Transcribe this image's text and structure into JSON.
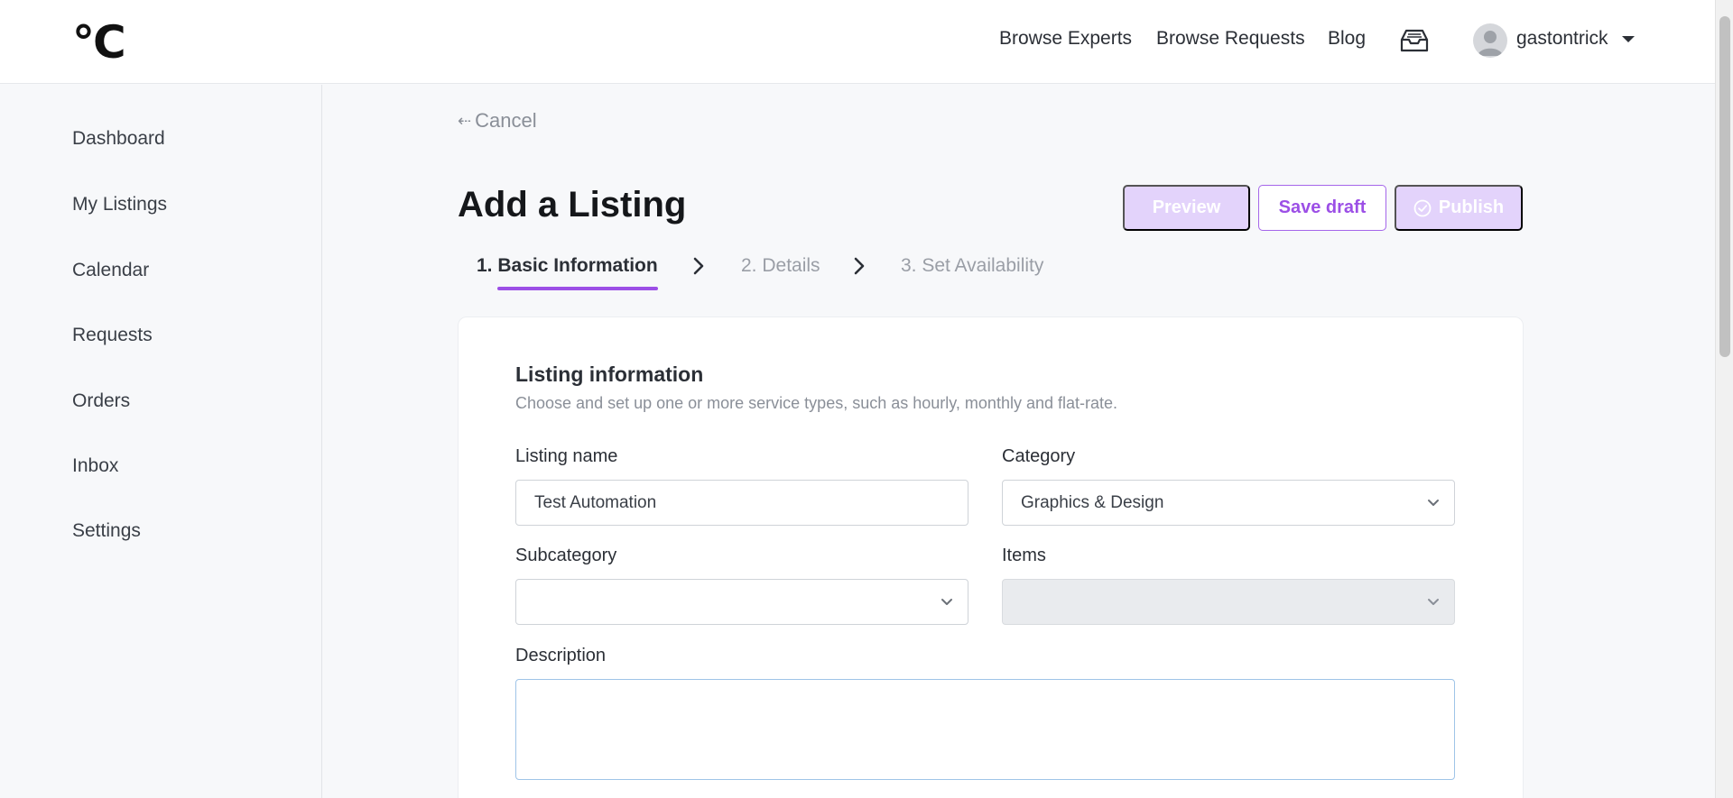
{
  "header": {
    "logo": "°C",
    "nav": [
      "Browse Experts",
      "Browse Requests",
      "Blog"
    ],
    "username": "gastontrick"
  },
  "sidebar": {
    "items": [
      "Dashboard",
      "My Listings",
      "Calendar",
      "Requests",
      "Orders",
      "Inbox",
      "Settings"
    ]
  },
  "main": {
    "cancel": "Cancel",
    "title": "Add a Listing",
    "buttons": {
      "preview": "Preview",
      "save_draft": "Save draft",
      "publish": "Publish"
    },
    "steps": [
      "1. Basic Information",
      "2. Details",
      "3. Set Availability"
    ],
    "active_step": 0,
    "accent_color": "#9c4fe6"
  },
  "form": {
    "section_title": "Listing information",
    "section_subtitle": "Choose and set up one or more service types, such as hourly, monthly and flat-rate.",
    "listing_name_label": "Listing name",
    "listing_name_value": "Test Automation",
    "category_label": "Category",
    "category_value": "Graphics & Design",
    "subcategory_label": "Subcategory",
    "subcategory_value": "",
    "items_label": "Items",
    "items_value": "",
    "description_label": "Description",
    "description_value": ""
  }
}
